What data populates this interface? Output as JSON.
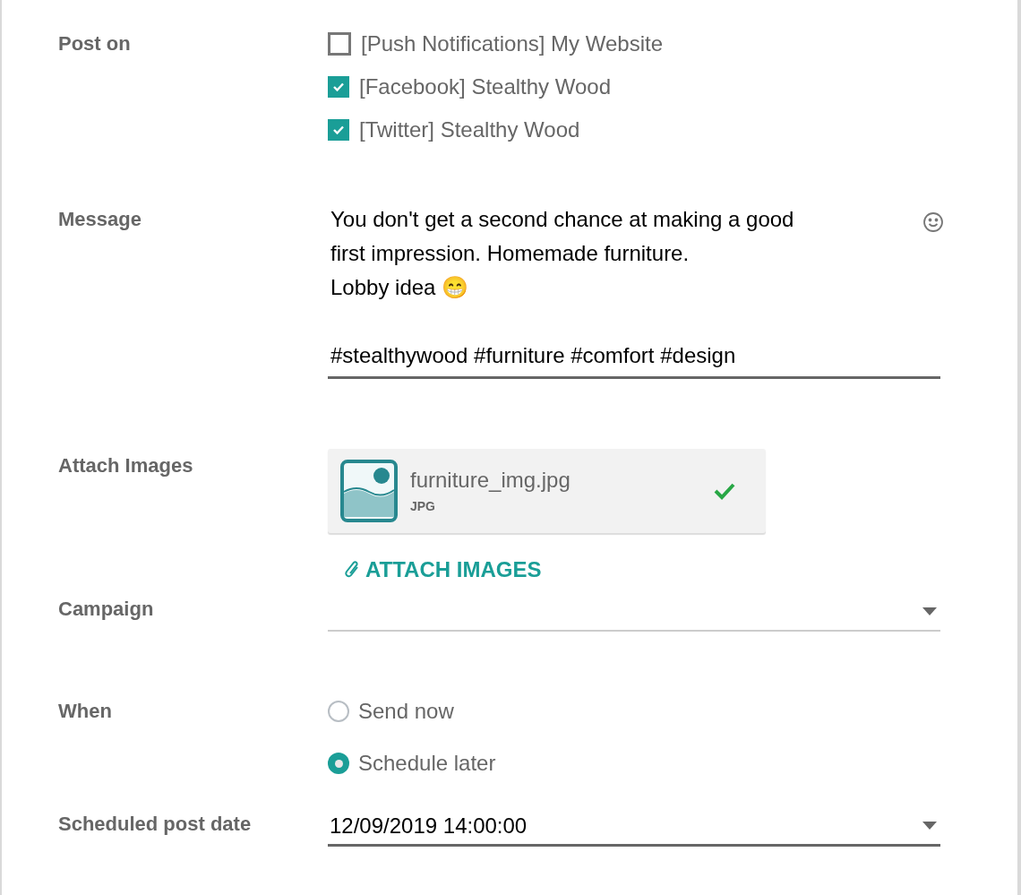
{
  "post_on": {
    "label": "Post on",
    "accounts": [
      {
        "label": "[Push Notifications] My Website",
        "checked": false
      },
      {
        "label": "[Facebook] Stealthy Wood",
        "checked": true
      },
      {
        "label": "[Twitter] Stealthy Wood",
        "checked": true
      }
    ]
  },
  "message": {
    "label": "Message",
    "value": "You don't get a second chance at making a good\nfirst impression. Homemade furniture.\nLobby idea 😁\n\n#stealthywood #furniture #comfort #design"
  },
  "attach_images": {
    "label": "Attach Images",
    "files": [
      {
        "name": "furniture_img.jpg",
        "type": "JPG",
        "uploaded": true
      }
    ],
    "button": "ATTACH IMAGES"
  },
  "campaign": {
    "label": "Campaign"
  },
  "when": {
    "label": "When",
    "options": [
      {
        "label": "Send now",
        "selected": false
      },
      {
        "label": "Schedule later",
        "selected": true
      }
    ]
  },
  "scheduled_post_date": {
    "label": "Scheduled post date",
    "value": "12/09/2019 14:00:00"
  }
}
